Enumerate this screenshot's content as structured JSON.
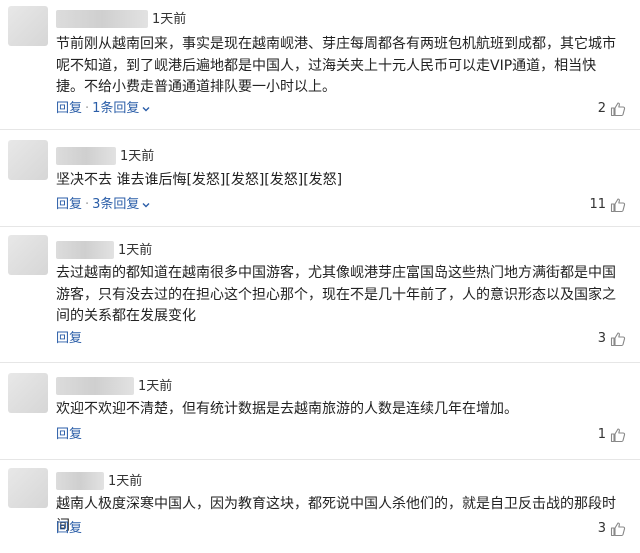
{
  "comments": [
    {
      "time": "1天前",
      "body": "节前刚从越南回来，事实是现在越南岘港、芽庄每周都各有两班包机航班到成都，其它城市呢不知道，到了岘港后遍地都是中国人，过海关夹上十元人民币可以走VIP通道，相当快捷。不给小费走普通通道排队要一小时以上。",
      "reply": "回复",
      "sep": "·",
      "replies": "1条回复",
      "likes": "2"
    },
    {
      "time": "1天前",
      "body": "坚决不去 谁去谁后悔[发怒][发怒][发怒][发怒]",
      "reply": "回复",
      "sep": "·",
      "replies": "3条回复",
      "likes": "11"
    },
    {
      "time": "1天前",
      "body": "去过越南的都知道在越南很多中国游客，尤其像岘港芽庄富国岛这些热门地方满街都是中国游客，只有没去过的在担心这个担心那个，现在不是几十年前了，人的意识形态以及国家之间的关系都在发展变化",
      "reply": "回复",
      "likes": "3"
    },
    {
      "time": "1天前",
      "body": "欢迎不欢迎不清楚，但有统计数据是去越南旅游的人数是连续几年在增加。",
      "reply": "回复",
      "likes": "1"
    },
    {
      "time": "1天前",
      "body": "越南人极度深寒中国人，因为教育这块，都死说中国人杀他们的，就是自卫反击战的那段时间",
      "reply": "回复",
      "likes": "3"
    }
  ]
}
